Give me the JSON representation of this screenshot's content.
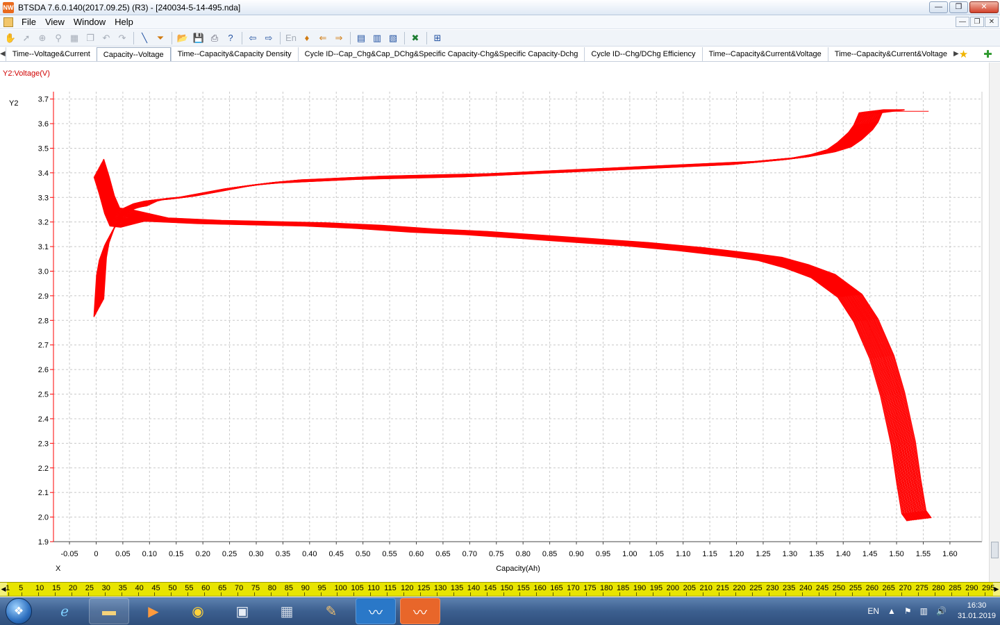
{
  "window": {
    "title": "BTSDA 7.6.0.140(2017.09.25) (R3) - [240034-5-14-495.nda]",
    "app_icon": "btsda-app-icon",
    "buttons": [
      "minimize-icon",
      "restore-icon",
      "close-icon"
    ]
  },
  "menu": {
    "items": [
      "File",
      "View",
      "Window",
      "Help"
    ]
  },
  "toolbar": {
    "icons": [
      "hand-icon",
      "pointer-icon",
      "zoom-region-icon",
      "zoom-icon",
      "grid-icon",
      "copy-icon",
      "undo-icon",
      "redo-icon",
      "line-icon",
      "filter-icon",
      "open-folder-icon",
      "save-icon",
      "print-icon",
      "help-icon",
      "back-icon",
      "forward-icon",
      "language-icon",
      "pin-icon",
      "align-left-icon",
      "align-right-icon",
      "table-icon",
      "table-edit-icon",
      "table-view-icon",
      "excel-icon",
      "qr-icon"
    ]
  },
  "tabs": {
    "items": [
      "Time--Voltage&Current",
      "Capacity--Voltage",
      "Time--Capacity&Capacity Density",
      "Cycle ID--Cap_Chg&Cap_DChg&Specific Capacity-Chg&Specific Capacity-Dchg",
      "Cycle ID--Chg/DChg Efficiency",
      "Time--Capacity&Current&Voltage",
      "Time--Capacity&Current&Voltage"
    ],
    "active_index": 1
  },
  "chart": {
    "caption": "Y2:Voltage(V)",
    "y_axis_tag": "Y2",
    "x_axis_tag": "X",
    "color": "#ff0000"
  },
  "chart_data": {
    "type": "line",
    "title": "",
    "xlabel": "Capacity(Ah)",
    "ylabel": "Y2:Voltage(V)",
    "xlim": [
      -0.08,
      1.66
    ],
    "ylim": [
      1.9,
      3.73
    ],
    "x_ticks": [
      "-0.05",
      "0",
      "0.05",
      "0.10",
      "0.15",
      "0.20",
      "0.25",
      "0.30",
      "0.35",
      "0.40",
      "0.45",
      "0.50",
      "0.55",
      "0.60",
      "0.65",
      "0.70",
      "0.75",
      "0.80",
      "0.85",
      "0.90",
      "0.95",
      "1.00",
      "1.05",
      "1.10",
      "1.15",
      "1.20",
      "1.25",
      "1.30",
      "1.35",
      "1.40",
      "1.45",
      "1.50",
      "1.55",
      "1.60"
    ],
    "y_ticks": [
      "1.9",
      "2.0",
      "2.1",
      "2.2",
      "2.3",
      "2.4",
      "2.5",
      "2.6",
      "2.7",
      "2.8",
      "2.9",
      "3.0",
      "3.1",
      "3.2",
      "3.3",
      "3.4",
      "3.5",
      "3.6",
      "3.7"
    ],
    "grid": true,
    "series": [
      {
        "x": [
          0.0,
          0.005,
          0.01,
          0.02,
          0.04,
          0.06,
          0.08,
          0.1,
          0.15,
          0.2,
          0.25,
          0.3,
          0.35,
          0.4,
          0.5,
          0.6,
          0.7,
          0.8,
          0.9,
          1.0,
          1.1,
          1.2,
          1.25,
          1.3,
          1.35,
          1.38,
          1.4,
          1.42,
          1.43,
          1.44,
          1.46,
          1.48
        ],
        "y": [
          2.85,
          3.02,
          3.08,
          3.14,
          3.22,
          3.26,
          3.28,
          3.29,
          3.3,
          3.32,
          3.34,
          3.355,
          3.365,
          3.37,
          3.38,
          3.385,
          3.39,
          3.4,
          3.41,
          3.42,
          3.43,
          3.44,
          3.45,
          3.46,
          3.48,
          3.5,
          3.53,
          3.57,
          3.6,
          3.65,
          3.65,
          3.65
        ]
      },
      {
        "x": [
          0.0,
          0.01,
          0.02,
          0.03,
          0.05,
          0.1,
          0.2,
          0.3,
          0.4,
          0.5,
          0.6,
          0.7,
          0.8,
          0.9,
          1.0,
          1.1,
          1.2,
          1.25,
          1.3,
          1.35,
          1.4,
          1.43,
          1.46,
          1.48,
          1.5,
          1.51,
          1.52,
          1.53
        ],
        "y": [
          3.42,
          3.35,
          3.27,
          3.22,
          3.215,
          3.21,
          3.2,
          3.195,
          3.19,
          3.18,
          3.165,
          3.155,
          3.14,
          3.125,
          3.11,
          3.09,
          3.065,
          3.05,
          3.02,
          2.98,
          2.9,
          2.8,
          2.65,
          2.5,
          2.3,
          2.15,
          2.02,
          1.99
        ]
      },
      {
        "x": [
          1.48,
          1.56
        ],
        "y": [
          3.65,
          3.65
        ]
      }
    ]
  },
  "ruler": {
    "labels": [
      "1",
      "5",
      "10",
      "15",
      "20",
      "25",
      "30",
      "35",
      "40",
      "45",
      "50",
      "55",
      "60",
      "65",
      "70",
      "75",
      "80",
      "85",
      "90",
      "95",
      "100",
      "105",
      "110",
      "115",
      "120",
      "125",
      "130",
      "135",
      "140",
      "145",
      "150",
      "155",
      "160",
      "165",
      "170",
      "175",
      "180",
      "185",
      "190",
      "195",
      "200",
      "205",
      "210",
      "215",
      "220",
      "225",
      "230",
      "235",
      "240",
      "245",
      "250",
      "255",
      "260",
      "265",
      "270",
      "275",
      "280",
      "285",
      "290",
      "295"
    ]
  },
  "taskbar": {
    "apps": [
      "start-orb-icon",
      "internet-explorer-icon",
      "file-explorer-icon",
      "media-player-icon",
      "chrome-icon",
      "virtualbox-icon",
      "calculator-icon",
      "paint-icon",
      "btsda-monitor-icon",
      "btsda-data-icon"
    ],
    "language": "EN",
    "time": "16:30",
    "date": "31.01.2019"
  }
}
